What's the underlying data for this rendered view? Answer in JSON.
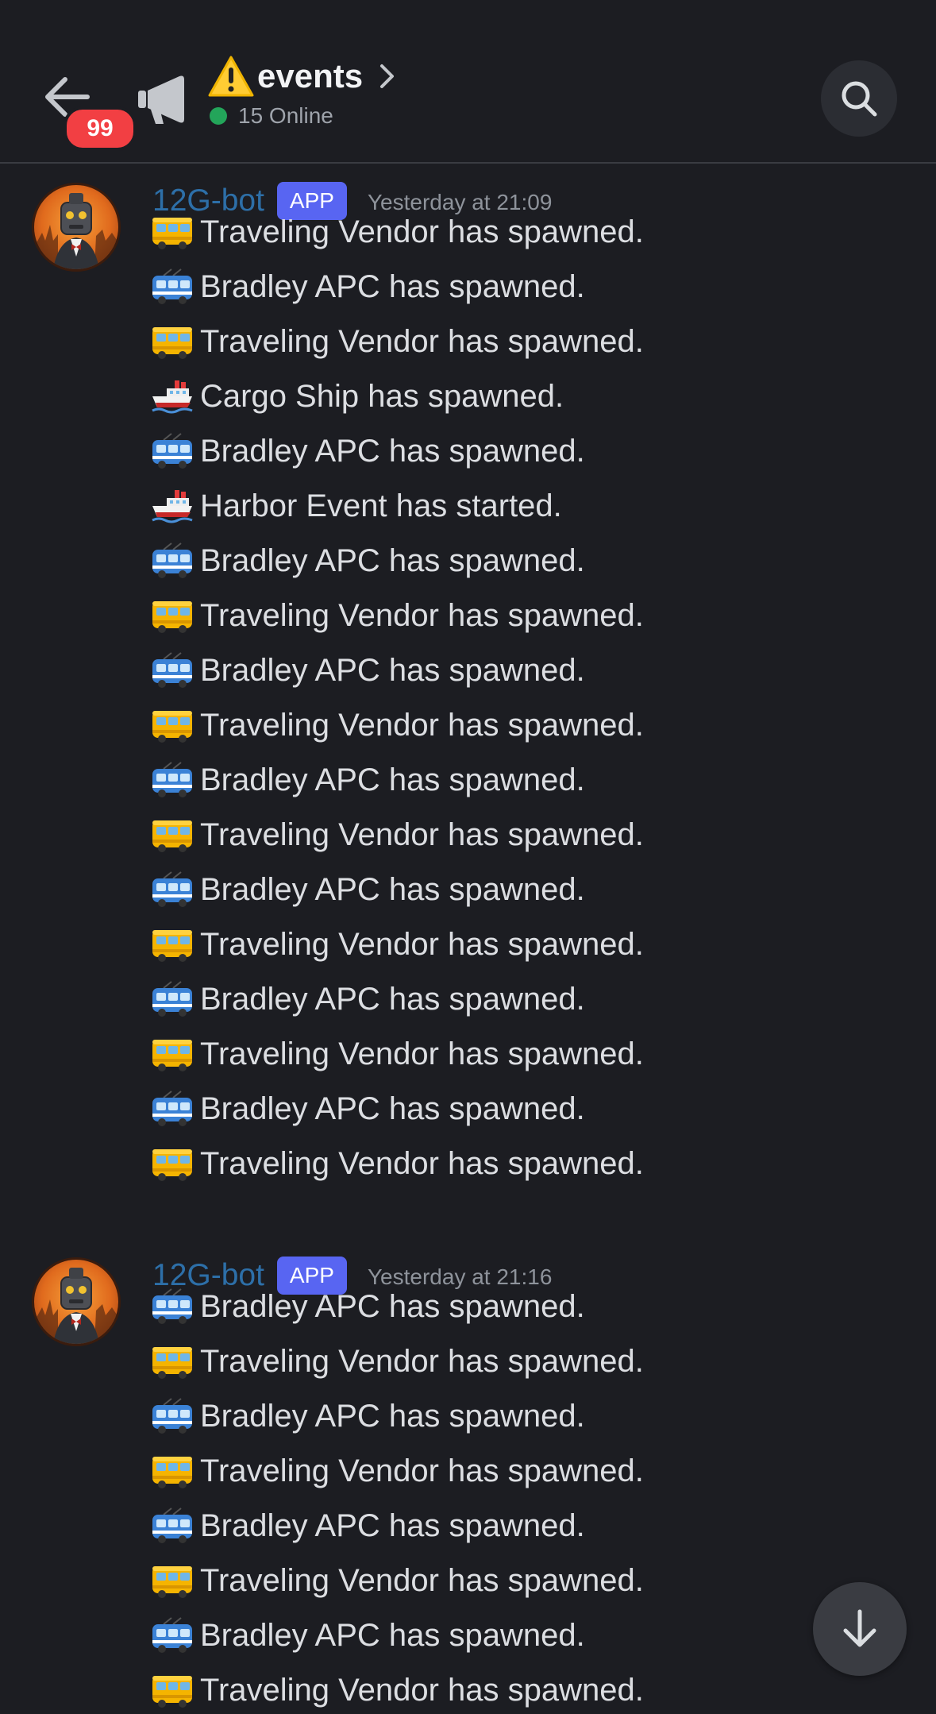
{
  "header": {
    "unread_count": "99",
    "channel_name": "events",
    "online_text": "15 Online"
  },
  "colors": {
    "background": "#1c1d22",
    "author": "#2d6fa8",
    "app_tag": "#5865f2",
    "badge": "#f23f43",
    "online": "#23a55a"
  },
  "icons": {
    "back": "arrow-left-icon",
    "channel_type": "megaphone-icon",
    "channel_emoji": "warning-icon",
    "header_chevron": "chevron-right-icon",
    "search": "search-icon",
    "scroll": "arrow-down-icon",
    "vendor": "bus-icon",
    "bradley": "trolleybus-icon",
    "ship": "ship-icon"
  },
  "messages": [
    {
      "author": "12G-bot",
      "tag": "APP",
      "timestamp": "Yesterday at 21:09",
      "lines": [
        {
          "icon": "bus-icon",
          "text": "Traveling Vendor has spawned."
        },
        {
          "icon": "trolleybus-icon",
          "text": "Bradley APC has spawned."
        },
        {
          "icon": "bus-icon",
          "text": "Traveling Vendor has spawned."
        },
        {
          "icon": "ship-icon",
          "text": "Cargo Ship has spawned."
        },
        {
          "icon": "trolleybus-icon",
          "text": "Bradley APC has spawned."
        },
        {
          "icon": "ship-icon",
          "text": "Harbor Event has started."
        },
        {
          "icon": "trolleybus-icon",
          "text": "Bradley APC has spawned."
        },
        {
          "icon": "bus-icon",
          "text": "Traveling Vendor has spawned."
        },
        {
          "icon": "trolleybus-icon",
          "text": "Bradley APC has spawned."
        },
        {
          "icon": "bus-icon",
          "text": "Traveling Vendor has spawned."
        },
        {
          "icon": "trolleybus-icon",
          "text": "Bradley APC has spawned."
        },
        {
          "icon": "bus-icon",
          "text": "Traveling Vendor has spawned."
        },
        {
          "icon": "trolleybus-icon",
          "text": "Bradley APC has spawned."
        },
        {
          "icon": "bus-icon",
          "text": "Traveling Vendor has spawned."
        },
        {
          "icon": "trolleybus-icon",
          "text": "Bradley APC has spawned."
        },
        {
          "icon": "bus-icon",
          "text": "Traveling Vendor has spawned."
        },
        {
          "icon": "trolleybus-icon",
          "text": "Bradley APC has spawned."
        },
        {
          "icon": "bus-icon",
          "text": "Traveling Vendor has spawned."
        }
      ]
    },
    {
      "author": "12G-bot",
      "tag": "APP",
      "timestamp": "Yesterday at 21:16",
      "lines": [
        {
          "icon": "trolleybus-icon",
          "text": "Bradley APC has spawned."
        },
        {
          "icon": "bus-icon",
          "text": "Traveling Vendor has spawned."
        },
        {
          "icon": "trolleybus-icon",
          "text": "Bradley APC has spawned."
        },
        {
          "icon": "bus-icon",
          "text": "Traveling Vendor has spawned."
        },
        {
          "icon": "trolleybus-icon",
          "text": "Bradley APC has spawned."
        },
        {
          "icon": "bus-icon",
          "text": "Traveling Vendor has spawned."
        },
        {
          "icon": "trolleybus-icon",
          "text": "Bradley APC has spawned."
        },
        {
          "icon": "bus-icon",
          "text": "Traveling Vendor has spawned."
        }
      ]
    }
  ]
}
